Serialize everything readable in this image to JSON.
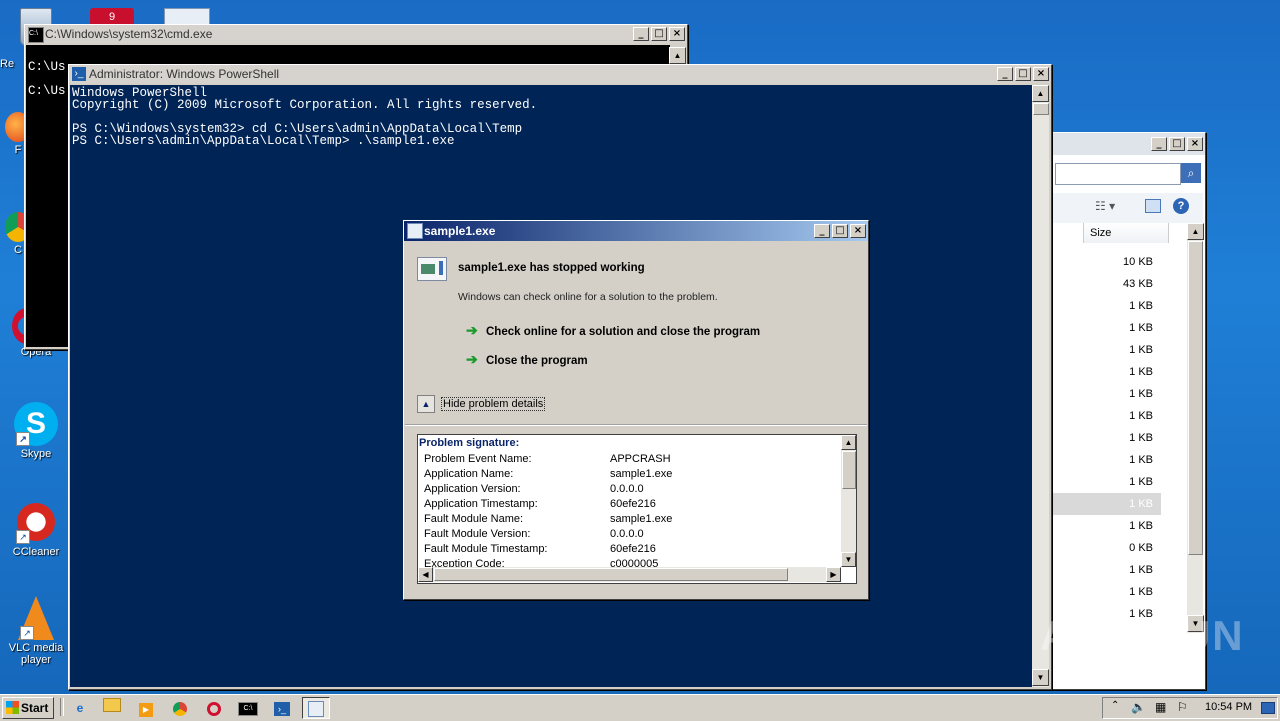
{
  "desktop": {
    "icons": [
      {
        "label": "Re"
      },
      {
        "label": "F"
      },
      {
        "label": "C"
      },
      {
        "label": "Opera"
      },
      {
        "label": "Skype"
      },
      {
        "label": "CCleaner"
      },
      {
        "label": "VLC media player"
      }
    ]
  },
  "cmd_window": {
    "title": "C:\\Windows\\system32\\cmd.exe",
    "lines": [
      "C:\\Us",
      "C:\\Us"
    ]
  },
  "powershell": {
    "title": "Administrator: Windows PowerShell",
    "lines": [
      "Windows PowerShell",
      "Copyright (C) 2009 Microsoft Corporation. All rights reserved.",
      "",
      "PS C:\\Windows\\system32> cd C:\\Users\\admin\\AppData\\Local\\Temp",
      "PS C:\\Users\\admin\\AppData\\Local\\Temp> .\\sample1.exe"
    ],
    "bg_color": "#012456"
  },
  "explorer": {
    "column_header": "Size",
    "sizes": [
      "10 KB",
      "43 KB",
      "1 KB",
      "1 KB",
      "1 KB",
      "1 KB",
      "1 KB",
      "1 KB",
      "1 KB",
      "1 KB",
      "1 KB",
      "1 KB",
      "1 KB",
      "0 KB",
      "1 KB",
      "1 KB",
      "1 KB"
    ],
    "selected_index": 11
  },
  "dialog": {
    "title": "sample1.exe",
    "heading": "sample1.exe has stopped working",
    "message": "Windows can check online for a solution to the problem.",
    "option_check": "Check online for a solution and close the program",
    "option_close": "Close the program",
    "details_toggle": "Hide problem details",
    "signature_title": "Problem signature:",
    "signature": [
      {
        "k": "Problem Event Name:",
        "v": "APPCRASH"
      },
      {
        "k": "Application Name:",
        "v": "sample1.exe"
      },
      {
        "k": "Application Version:",
        "v": "0.0.0.0"
      },
      {
        "k": "Application Timestamp:",
        "v": "60efe216"
      },
      {
        "k": "Fault Module Name:",
        "v": "sample1.exe"
      },
      {
        "k": "Fault Module Version:",
        "v": "0.0.0.0"
      },
      {
        "k": "Fault Module Timestamp:",
        "v": "60efe216"
      },
      {
        "k": "Exception Code:",
        "v": "c0000005"
      }
    ]
  },
  "taskbar": {
    "start_label": "Start",
    "clock": "10:54 PM"
  },
  "watermark": "ANY RUN"
}
